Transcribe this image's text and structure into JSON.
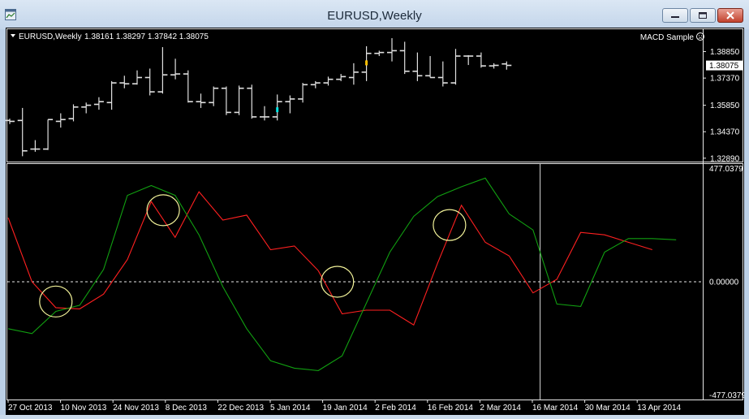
{
  "window": {
    "title": "EURUSD,Weekly"
  },
  "chart_header": {
    "symbol": "EURUSD,Weekly",
    "ohlc": "1.38161 1.38297 1.37842 1.38075",
    "indicator_name": "MACD Sample"
  },
  "chart_data": [
    {
      "type": "ohlc",
      "title": "EURUSD,Weekly",
      "y_ticks": [
        "1.38850",
        "1.37370",
        "1.35850",
        "1.34370",
        "1.32890"
      ],
      "y_tick_values": [
        1.3885,
        1.3737,
        1.3585,
        1.3437,
        1.3289
      ],
      "ylim": [
        1.327,
        1.401
      ],
      "current_price": "1.38075",
      "bars": [
        {
          "o": 1.35,
          "h": 1.351,
          "l": 1.348,
          "c": 1.3495
        },
        {
          "o": 1.35,
          "h": 1.357,
          "l": 1.33,
          "c": 1.333
        },
        {
          "o": 1.334,
          "h": 1.339,
          "l": 1.3325,
          "c": 1.334
        },
        {
          "o": 1.334,
          "h": 1.3505,
          "l": 1.3335,
          "c": 1.3505
        },
        {
          "o": 1.3495,
          "h": 1.354,
          "l": 1.346,
          "c": 1.3505
        },
        {
          "o": 1.351,
          "h": 1.359,
          "l": 1.3495,
          "c": 1.3575
        },
        {
          "o": 1.3575,
          "h": 1.36,
          "l": 1.354,
          "c": 1.3585
        },
        {
          "o": 1.359,
          "h": 1.363,
          "l": 1.356,
          "c": 1.3605
        },
        {
          "o": 1.36,
          "h": 1.372,
          "l": 1.356,
          "c": 1.371
        },
        {
          "o": 1.371,
          "h": 1.375,
          "l": 1.368,
          "c": 1.3705
        },
        {
          "o": 1.3705,
          "h": 1.378,
          "l": 1.37,
          "c": 1.374
        },
        {
          "o": 1.374,
          "h": 1.379,
          "l": 1.364,
          "c": 1.366
        },
        {
          "o": 1.366,
          "h": 1.391,
          "l": 1.365,
          "c": 1.3755
        },
        {
          "o": 1.3755,
          "h": 1.3845,
          "l": 1.373,
          "c": 1.376
        },
        {
          "o": 1.376,
          "h": 1.378,
          "l": 1.36,
          "c": 1.3605
        },
        {
          "o": 1.3605,
          "h": 1.365,
          "l": 1.357,
          "c": 1.36
        },
        {
          "o": 1.36,
          "h": 1.369,
          "l": 1.358,
          "c": 1.368
        },
        {
          "o": 1.368,
          "h": 1.369,
          "l": 1.353,
          "c": 1.3545
        },
        {
          "o": 1.3545,
          "h": 1.3695,
          "l": 1.353,
          "c": 1.368
        },
        {
          "o": 1.368,
          "h": 1.37,
          "l": 1.351,
          "c": 1.352
        },
        {
          "o": 1.352,
          "h": 1.358,
          "l": 1.35,
          "c": 1.352
        },
        {
          "o": 1.352,
          "h": 1.3645,
          "l": 1.35,
          "c": 1.3605
        },
        {
          "o": 1.3605,
          "h": 1.364,
          "l": 1.354,
          "c": 1.362
        },
        {
          "o": 1.362,
          "h": 1.371,
          "l": 1.36,
          "c": 1.37
        },
        {
          "o": 1.37,
          "h": 1.372,
          "l": 1.368,
          "c": 1.371
        },
        {
          "o": 1.371,
          "h": 1.3745,
          "l": 1.3695,
          "c": 1.373
        },
        {
          "o": 1.373,
          "h": 1.376,
          "l": 1.372,
          "c": 1.3745
        },
        {
          "o": 1.374,
          "h": 1.382,
          "l": 1.37,
          "c": 1.377
        },
        {
          "o": 1.377,
          "h": 1.3915,
          "l": 1.372,
          "c": 1.3875
        },
        {
          "o": 1.3875,
          "h": 1.389,
          "l": 1.386,
          "c": 1.388
        },
        {
          "o": 1.388,
          "h": 1.396,
          "l": 1.383,
          "c": 1.389
        },
        {
          "o": 1.389,
          "h": 1.394,
          "l": 1.376,
          "c": 1.3775
        },
        {
          "o": 1.3775,
          "h": 1.388,
          "l": 1.372,
          "c": 1.375
        },
        {
          "o": 1.375,
          "h": 1.386,
          "l": 1.374,
          "c": 1.374
        },
        {
          "o": 1.374,
          "h": 1.383,
          "l": 1.369,
          "c": 1.371
        },
        {
          "o": 1.371,
          "h": 1.39,
          "l": 1.37,
          "c": 1.386
        },
        {
          "o": 1.386,
          "h": 1.3865,
          "l": 1.381,
          "c": 1.386
        },
        {
          "o": 1.386,
          "h": 1.388,
          "l": 1.3795,
          "c": 1.3805
        },
        {
          "o": 1.3805,
          "h": 1.382,
          "l": 1.379,
          "c": 1.3808
        },
        {
          "o": 1.3816,
          "h": 1.383,
          "l": 1.3784,
          "c": 1.3808
        }
      ],
      "markers": [
        {
          "bar": 21,
          "price": 1.356,
          "color": "#00e5e5"
        },
        {
          "bar": 28,
          "price": 1.3822,
          "color": "#ffc000"
        }
      ]
    },
    {
      "type": "line",
      "indicator": "MACD Sample",
      "y_ticks": [
        "477.0379",
        "0.00000",
        "-477.0379"
      ],
      "y_tick_values": [
        477.0379,
        0,
        -477.0379
      ],
      "ylim": [
        -477.0379,
        477.0379
      ],
      "x_tick_labels": [
        "27 Oct 2013",
        "10 Nov 2013",
        "24 Nov 2013",
        "8 Dec 2013",
        "22 Dec 2013",
        "5 Jan 2014",
        "19 Jan 2014",
        "2 Feb 2014",
        "16 Feb 2014",
        "2 Mar 2014",
        "16 Mar 2014",
        "30 Mar 2014",
        "13 Apr 2014"
      ],
      "series": [
        {
          "color": "#ff2020",
          "values": [
            260,
            0,
            -105,
            -110,
            -50,
            90,
            325,
            180,
            365,
            250,
            270,
            130,
            145,
            45,
            -130,
            -115,
            -115,
            -175,
            75,
            310,
            160,
            105,
            -45,
            10,
            200,
            190,
            160,
            130
          ]
        },
        {
          "color": "#11a011",
          "values": [
            -190,
            -210,
            -120,
            -95,
            50,
            350,
            390,
            350,
            190,
            -20,
            -190,
            -320,
            -350,
            -360,
            -300,
            -90,
            120,
            265,
            345,
            385,
            420,
            275,
            210,
            -90,
            -100,
            120,
            175,
            175,
            170
          ]
        }
      ],
      "highlight_circles": [
        {
          "x_index": 2,
          "value": -80
        },
        {
          "x_index": 6.5,
          "value": 290
        },
        {
          "x_index": 13.8,
          "value": 0
        },
        {
          "x_index": 18.5,
          "value": 230
        }
      ],
      "crosshair_index": 22.3
    }
  ]
}
